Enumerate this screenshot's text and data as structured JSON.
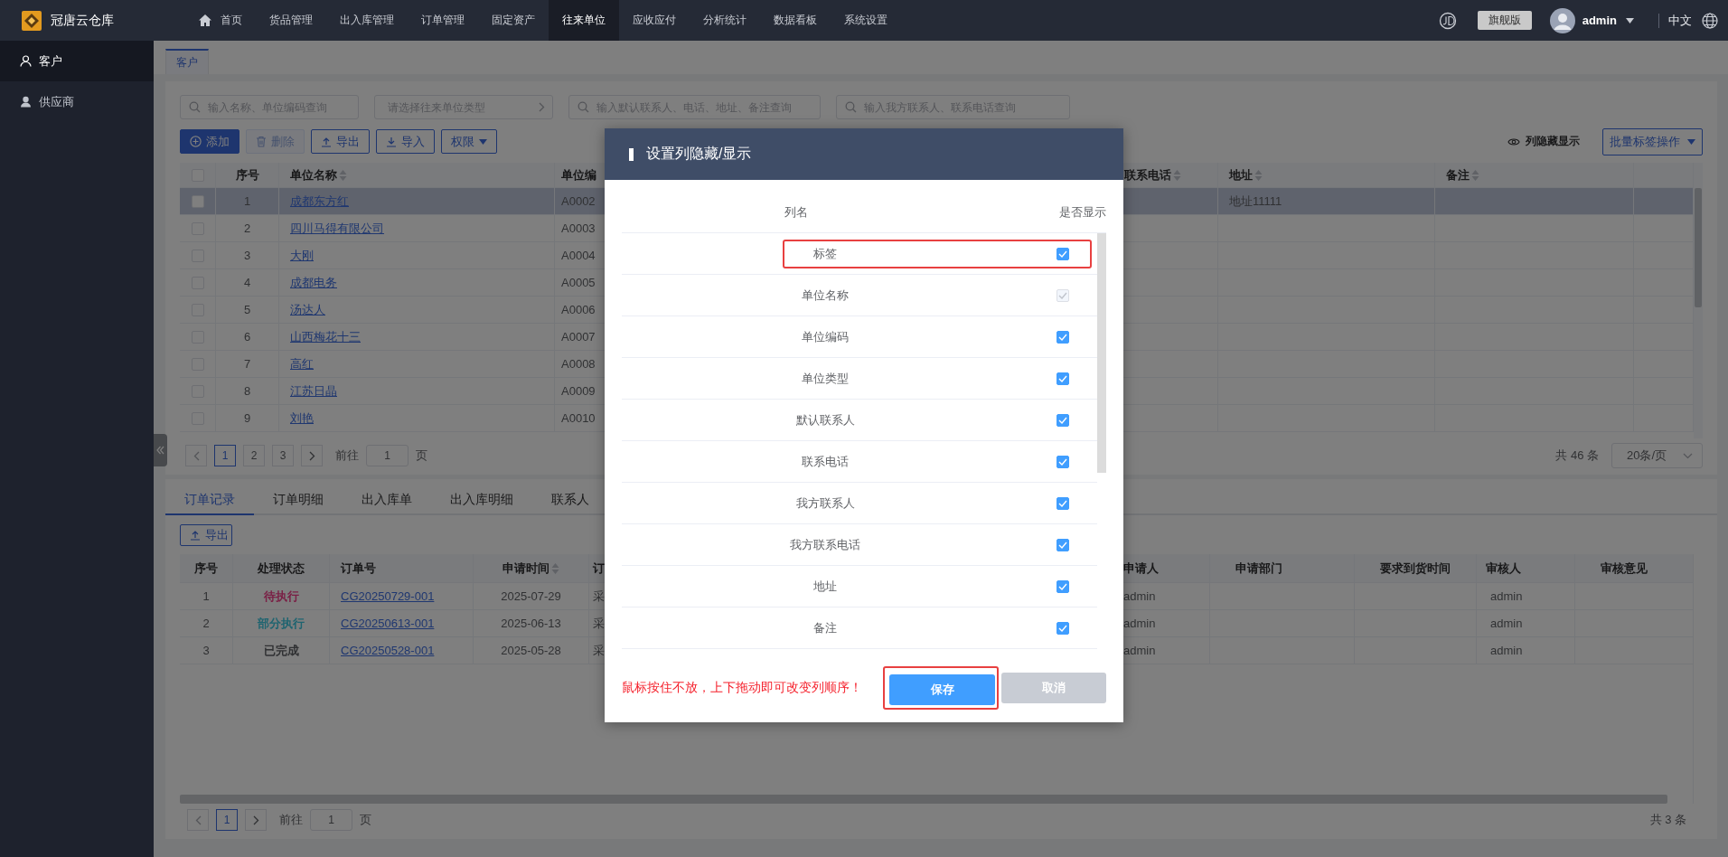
{
  "app": {
    "name": "冠唐云仓库"
  },
  "nav": [
    {
      "label": "首页",
      "kind": "home",
      "selected": false
    },
    {
      "label": "货品管理",
      "kind": "link",
      "selected": false
    },
    {
      "label": "出入库管理",
      "kind": "link",
      "selected": false
    },
    {
      "label": "订单管理",
      "kind": "link",
      "selected": false
    },
    {
      "label": "固定资产",
      "kind": "link",
      "selected": false
    },
    {
      "label": "往来单位",
      "kind": "link",
      "selected": true
    },
    {
      "label": "应收应付",
      "kind": "link",
      "selected": false
    },
    {
      "label": "分析统计",
      "kind": "link",
      "selected": false
    },
    {
      "label": "数据看板",
      "kind": "link",
      "selected": false
    },
    {
      "label": "系统设置",
      "kind": "link",
      "selected": false
    }
  ],
  "account": {
    "edition": "旗舰版",
    "user": "admin",
    "language": "中文"
  },
  "sidebar": {
    "items": [
      {
        "label": "客户",
        "kind": "outline",
        "selected": true
      },
      {
        "label": "供应商",
        "kind": "filled",
        "selected": false
      }
    ]
  },
  "page_tabs": [
    {
      "label": "客户",
      "selected": true
    }
  ],
  "filters": [
    {
      "kind": "search",
      "placeholder": "输入名称、单位编码查询"
    },
    {
      "kind": "select",
      "placeholder": "请选择往来单位类型"
    },
    {
      "kind": "search",
      "placeholder": "输入默认联系人、电话、地址、备注查询"
    },
    {
      "kind": "search",
      "placeholder": "输入我方联系人、联系电话查询"
    }
  ],
  "toolbar": {
    "buttons": [
      {
        "label": "添加",
        "kind": "add",
        "disabled": false
      },
      {
        "label": "删除",
        "kind": "delete",
        "disabled": true
      },
      {
        "label": "导出",
        "kind": "export",
        "disabled": false
      },
      {
        "label": "导入",
        "kind": "import",
        "disabled": false
      },
      {
        "label": "权限",
        "kind": "menu",
        "disabled": false
      }
    ],
    "column_toggle": "列隐藏显示",
    "batch_menu": "批量标签操作"
  },
  "customers": {
    "columns": [
      {
        "label": "序号",
        "sortable": false
      },
      {
        "label": "单位名称",
        "sortable": true
      },
      {
        "label": "单位编"
      },
      {
        "label": "联系电话",
        "sortable": true
      },
      {
        "label": "地址",
        "sortable": true
      },
      {
        "label": "备注",
        "sortable": true
      }
    ],
    "select_all": {
      "checked": false
    },
    "rows": [
      {
        "index": "1",
        "name": "成都东方红",
        "code": "A0002",
        "address": "地址11111",
        "selected": true,
        "checked": false
      },
      {
        "index": "2",
        "name": "四川马得有限公司",
        "code": "A0003",
        "selected": false,
        "checked": false
      },
      {
        "index": "3",
        "name": "大刚",
        "code": "A0004",
        "selected": false,
        "checked": false
      },
      {
        "index": "4",
        "name": "成都电务",
        "code": "A0005",
        "selected": false,
        "checked": false
      },
      {
        "index": "5",
        "name": "汤达人",
        "code": "A0006",
        "selected": false,
        "checked": false
      },
      {
        "index": "6",
        "name": "山西梅花十三",
        "code": "A0007",
        "selected": false,
        "checked": false
      },
      {
        "index": "7",
        "name": "高红",
        "code": "A0008",
        "selected": false,
        "checked": false
      },
      {
        "index": "8",
        "name": "江苏日晶",
        "code": "A0009",
        "selected": false,
        "checked": false
      },
      {
        "index": "9",
        "name": "刘艳",
        "code": "A0010",
        "selected": false,
        "checked": false
      }
    ],
    "pagination": {
      "pages": [
        {
          "label": "1",
          "selected": true
        },
        {
          "label": "2",
          "selected": false
        },
        {
          "label": "3",
          "selected": false
        }
      ],
      "goto": "前往",
      "goto_value": "1",
      "goto_unit": "页",
      "total": "共 46 条",
      "page_size": "20条/页"
    }
  },
  "detail_tabs": [
    {
      "label": "订单记录",
      "selected": true
    },
    {
      "label": "订单明细",
      "selected": false
    },
    {
      "label": "出入库单",
      "selected": false
    },
    {
      "label": "出入库明细",
      "selected": false
    },
    {
      "label": "联系人",
      "selected": false
    }
  ],
  "orders": {
    "export": "导出",
    "columns": [
      {
        "label": "序号",
        "sortable": false
      },
      {
        "label": "处理状态",
        "sortable": false
      },
      {
        "label": "订单号",
        "sortable": false
      },
      {
        "label": "申请时间",
        "sortable": true
      },
      {
        "label": "订"
      },
      {
        "label": "申请人",
        "sortable": false
      },
      {
        "label": "申请部门",
        "sortable": false
      },
      {
        "label": "要求到货时间",
        "sortable": false
      },
      {
        "label": "审核人",
        "sortable": false
      },
      {
        "label": "审核意见",
        "sortable": false
      }
    ],
    "rows": [
      {
        "index": "1",
        "status": "待执行",
        "color": "#7a1f45",
        "order_no": "CG20250729-001",
        "date": "2025-07-29",
        "type": "采",
        "applicant": "admin",
        "reviewer": "admin"
      },
      {
        "index": "2",
        "status": "部分执行",
        "color": "#1f6470",
        "order_no": "CG20250613-001",
        "date": "2025-06-13",
        "type": "采",
        "applicant": "admin",
        "reviewer": "admin"
      },
      {
        "index": "3",
        "status": "已完成",
        "color": "#303133",
        "order_no": "CG20250528-001",
        "date": "2025-05-28",
        "type": "采",
        "applicant": "admin",
        "reviewer": "admin"
      }
    ],
    "pagination": {
      "pages": [
        {
          "label": "1",
          "selected": true
        }
      ],
      "goto": "前往",
      "goto_value": "1",
      "goto_unit": "页",
      "total": "共 3 条"
    }
  },
  "dialog": {
    "title": "设置列隐藏/显示",
    "name_header": "列名",
    "visible_header": "是否显示",
    "rows": [
      {
        "label": "标签",
        "checked": true,
        "disabled": false,
        "highlighted": true
      },
      {
        "label": "单位名称",
        "checked": true,
        "disabled": true,
        "highlighted": false
      },
      {
        "label": "单位编码",
        "checked": true,
        "disabled": false,
        "highlighted": false
      },
      {
        "label": "单位类型",
        "checked": true,
        "disabled": false,
        "highlighted": false
      },
      {
        "label": "默认联系人",
        "checked": true,
        "disabled": false,
        "highlighted": false
      },
      {
        "label": "联系电话",
        "checked": true,
        "disabled": false,
        "highlighted": false
      },
      {
        "label": "我方联系人",
        "checked": true,
        "disabled": false,
        "highlighted": false
      },
      {
        "label": "我方联系电话",
        "checked": true,
        "disabled": false,
        "highlighted": false
      },
      {
        "label": "地址",
        "checked": true,
        "disabled": false,
        "highlighted": false
      },
      {
        "label": "备注",
        "checked": true,
        "disabled": false,
        "highlighted": false
      }
    ],
    "hint": "鼠标按住不放，上下拖动即可改变列顺序！",
    "buttons": [
      {
        "label": "保存",
        "kind": "primary",
        "highlighted": true
      },
      {
        "label": "取消",
        "kind": "cancel",
        "highlighted": false
      }
    ]
  }
}
